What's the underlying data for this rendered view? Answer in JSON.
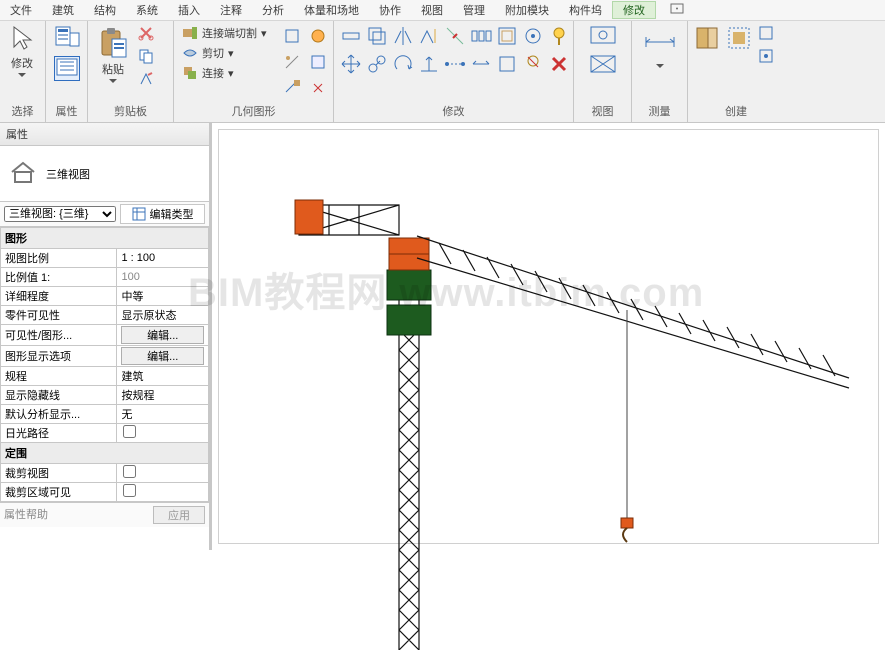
{
  "menu": {
    "items": [
      "文件",
      "建筑",
      "结构",
      "系统",
      "插入",
      "注释",
      "分析",
      "体量和场地",
      "协作",
      "视图",
      "管理",
      "附加模块",
      "构件坞",
      "修改"
    ],
    "activeIndex": 13
  },
  "ribbon": {
    "select": {
      "label": "选择",
      "modify": "修改"
    },
    "properties": {
      "label": "属性"
    },
    "clipboard": {
      "label": "剪贴板",
      "paste": "粘贴"
    },
    "geometry": {
      "label": "几何图形",
      "cope": "连接端切割",
      "cut": "剪切",
      "join": "连接"
    },
    "modify": {
      "label": "修改"
    },
    "view": {
      "label": "视图"
    },
    "measure": {
      "label": "测量"
    },
    "create": {
      "label": "创建"
    }
  },
  "properties": {
    "panelTitle": "属性",
    "familyName": "三维视图",
    "typeSelector": "三维视图: {三维}",
    "editType": "编辑类型",
    "sections": {
      "graphics": "图形",
      "extents": "定围"
    },
    "rows": {
      "viewScale": {
        "k": "视图比例",
        "v": "1 : 100"
      },
      "scaleValue": {
        "k": "比例值 1:",
        "v": "100"
      },
      "detailLevel": {
        "k": "详细程度",
        "v": "中等"
      },
      "partsVis": {
        "k": "零件可见性",
        "v": "显示原状态"
      },
      "vgOverrides": {
        "k": "可见性/图形...",
        "v": "编辑..."
      },
      "graphDisplay": {
        "k": "图形显示选项",
        "v": "编辑..."
      },
      "discipline": {
        "k": "规程",
        "v": "建筑"
      },
      "showHidden": {
        "k": "显示隐藏线",
        "v": "按规程"
      },
      "defaultAnalysis": {
        "k": "默认分析显示...",
        "v": "无"
      },
      "sunPath": {
        "k": "日光路径",
        "v": false
      },
      "cropView": {
        "k": "裁剪视图",
        "v": false
      },
      "cropVisible": {
        "k": "裁剪区域可见",
        "v": false
      }
    },
    "footer": {
      "help": "属性帮助",
      "apply": "应用"
    }
  },
  "canvas": {
    "watermark": "BIM教程网 www.itbim.com"
  }
}
